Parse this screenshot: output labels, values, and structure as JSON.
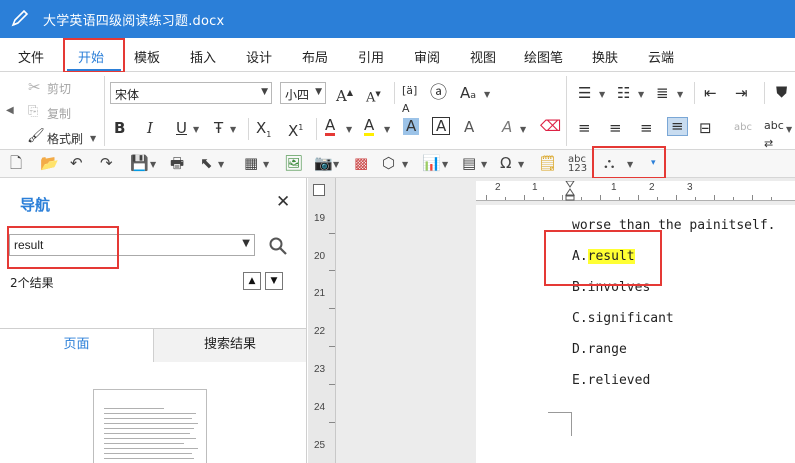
{
  "window": {
    "title": "大学英语四级阅读练习题.docx"
  },
  "menu": [
    {
      "label": "文件",
      "active": false
    },
    {
      "label": "开始",
      "active": true
    },
    {
      "label": "模板",
      "active": false
    },
    {
      "label": "插入",
      "active": false
    },
    {
      "label": "设计",
      "active": false
    },
    {
      "label": "布局",
      "active": false
    },
    {
      "label": "引用",
      "active": false
    },
    {
      "label": "审阅",
      "active": false
    },
    {
      "label": "视图",
      "active": false
    },
    {
      "label": "绘图笔",
      "active": false
    },
    {
      "label": "换肤",
      "active": false
    },
    {
      "label": "云端",
      "active": false
    }
  ],
  "ribbon": {
    "cut": "剪切",
    "copy": "复制",
    "format_painter": "格式刷",
    "font_name": "宋体",
    "font_size": "小四"
  },
  "nav": {
    "title": "导航",
    "search_value": "result",
    "result_count": "2个结果",
    "tabs": [
      "页面",
      "搜索结果"
    ]
  },
  "doc": {
    "lines": [
      {
        "prefix": "worse than the painitself.",
        "hl": "",
        "suffix": ""
      },
      {
        "prefix": "A.",
        "hl": "result",
        "suffix": ""
      },
      {
        "prefix": "B.involves",
        "hl": "",
        "suffix": ""
      },
      {
        "prefix": "C.significant",
        "hl": "",
        "suffix": ""
      },
      {
        "prefix": "D.range",
        "hl": "",
        "suffix": ""
      },
      {
        "prefix": "E.relieved",
        "hl": "",
        "suffix": ""
      }
    ],
    "vruler_numbers": [
      "19",
      "20",
      "21",
      "22",
      "23",
      "24",
      "25"
    ],
    "hruler_numbers": [
      "2",
      "1",
      "1",
      "2",
      "3"
    ]
  },
  "colors": {
    "accent": "#2b7fd8",
    "highlight": "#ffff33",
    "annotation": "#e53935"
  }
}
